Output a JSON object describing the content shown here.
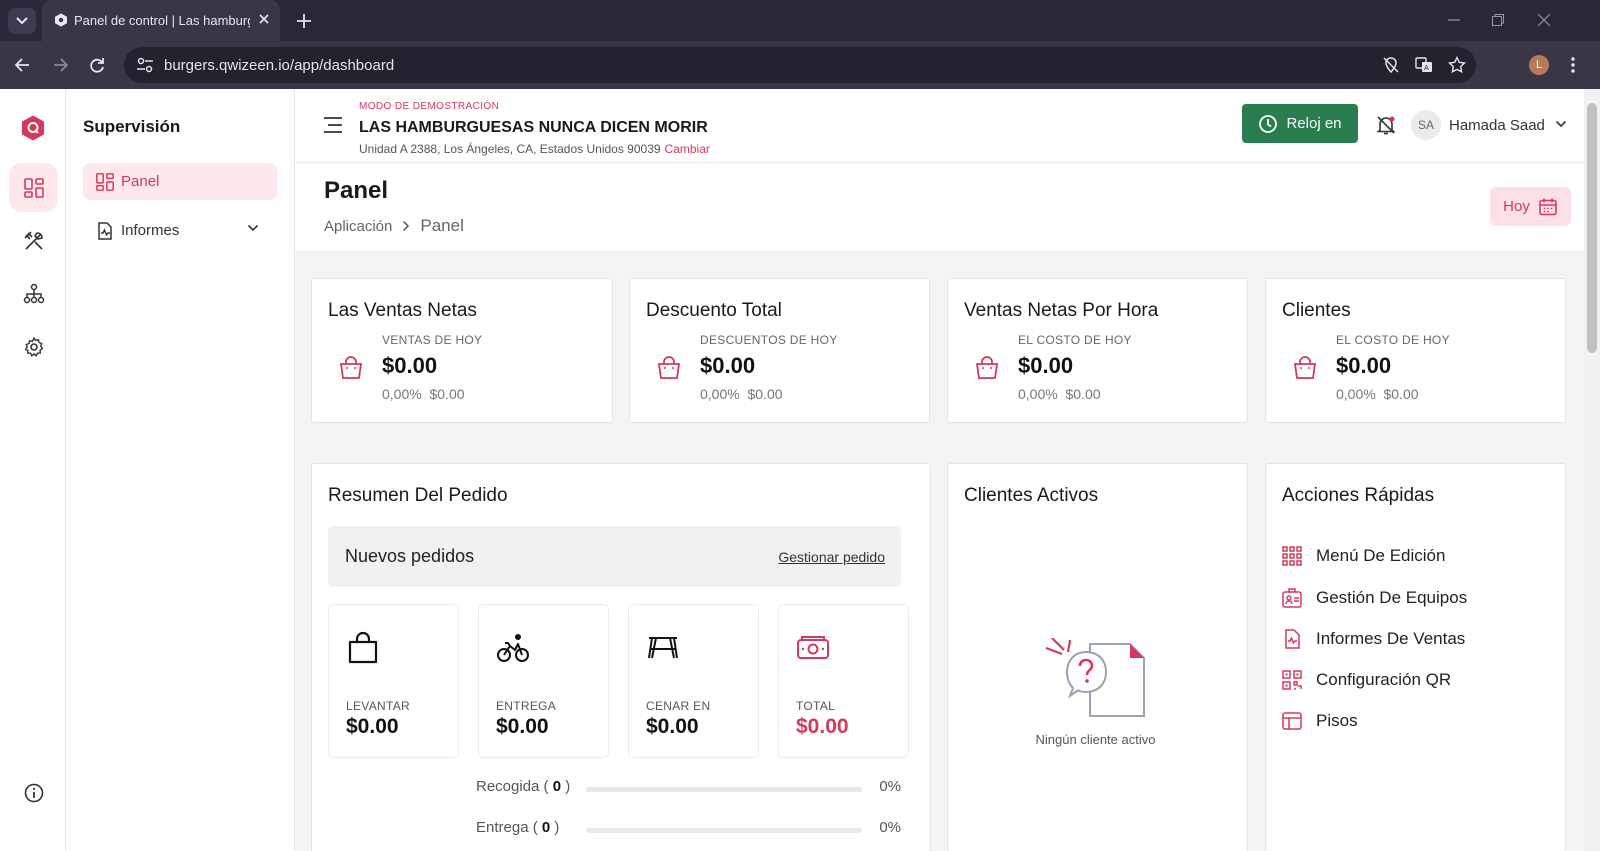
{
  "browser": {
    "tab_title": "Panel de control | Las hamburguesas",
    "url": "burgers.qwizeen.io/app/dashboard",
    "profile_initial": "L"
  },
  "sidebar": {
    "title": "Supervisión",
    "items": [
      {
        "label": "Panel",
        "active": true
      },
      {
        "label": "Informes",
        "active": false
      }
    ]
  },
  "header": {
    "demo_label": "MODO DE DEMOSTRACIÓN",
    "store_name": "LAS HAMBURGUESAS NUNCA DICEN MORIR",
    "address": "Unidad A 2388, Los Ángeles, CA, Estados Unidos 90039",
    "change_link": "Cambiar",
    "clock_button": "Reloj en",
    "user_initials": "SA",
    "user_name": "Hamada Saad"
  },
  "page": {
    "title": "Panel",
    "breadcrumb": [
      "Aplicación",
      "Panel"
    ],
    "today_button": "Hoy"
  },
  "stats": [
    {
      "title": "Las Ventas Netas",
      "sub": "VENTAS DE HOY",
      "value": "$0.00",
      "pct": "0,00%",
      "prev": "$0.00"
    },
    {
      "title": "Descuento Total",
      "sub": "DESCUENTOS DE HOY",
      "value": "$0.00",
      "pct": "0,00%",
      "prev": "$0.00"
    },
    {
      "title": "Ventas Netas Por Hora",
      "sub": "EL COSTO DE HOY",
      "value": "$0.00",
      "pct": "0,00%",
      "prev": "$0.00"
    },
    {
      "title": "Clientes",
      "sub": "EL COSTO DE HOY",
      "value": "$0.00",
      "pct": "0,00%",
      "prev": "$0.00"
    }
  ],
  "order_summary": {
    "title": "Resumen Del Pedido",
    "new_orders": "Nuevos pedidos",
    "manage_link": "Gestionar pedido",
    "types": [
      {
        "label": "LEVANTAR",
        "amount": "$0.00",
        "icon": "bag-icon"
      },
      {
        "label": "ENTREGA",
        "amount": "$0.00",
        "icon": "bike-icon"
      },
      {
        "label": "CENAR EN",
        "amount": "$0.00",
        "icon": "table-icon"
      },
      {
        "label": "TOTAL",
        "amount": "$0.00",
        "icon": "cash-icon"
      }
    ],
    "progress": [
      {
        "label": "Recogida",
        "count": "0",
        "pct": "0%",
        "fraction": 0
      },
      {
        "label": "Entrega",
        "count": "0",
        "pct": "0%",
        "fraction": 0
      }
    ]
  },
  "active_clients": {
    "title": "Clientes Activos",
    "empty_text": "Ningún cliente activo"
  },
  "quick_actions": {
    "title": "Acciones Rápidas",
    "items": [
      {
        "label": "Menú De Edición",
        "icon": "grid-icon"
      },
      {
        "label": "Gestión De Equipos",
        "icon": "id-card-icon"
      },
      {
        "label": "Informes De Ventas",
        "icon": "report-icon"
      },
      {
        "label": "Configuración QR",
        "icon": "qr-icon"
      },
      {
        "label": "Pisos",
        "icon": "layout-icon"
      }
    ]
  },
  "colors": {
    "accent": "#d5385a",
    "green": "#2a7d4f",
    "chrome": "#2b2638"
  }
}
